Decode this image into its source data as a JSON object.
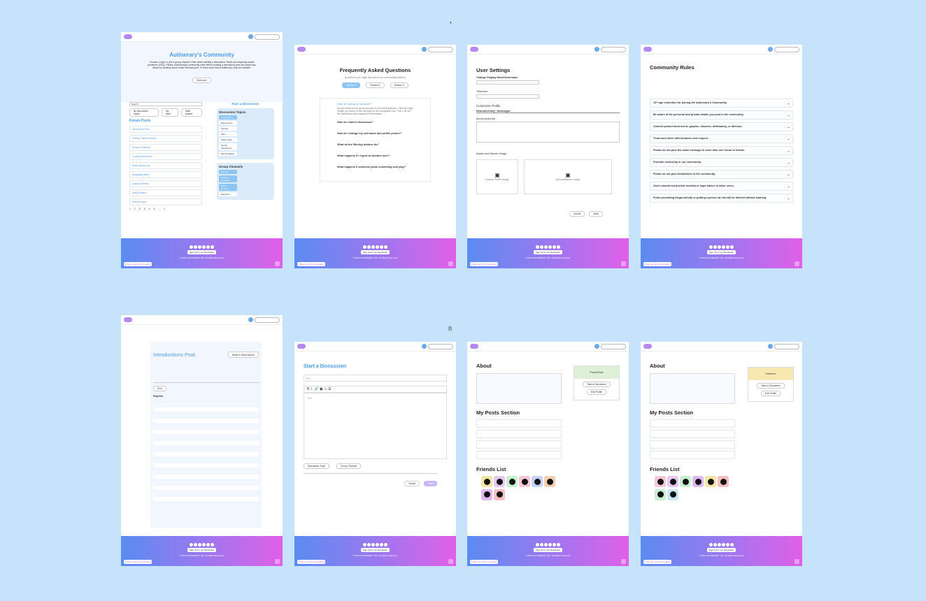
{
  "labels": {
    "a": "•",
    "b": "B"
  },
  "footer": {
    "newsletter": "Sign Up for our Newsletter",
    "crowd": "♥ See our K-S's Campaign!",
    "copy": "© 2024 AUTINERARY INC. All Rights Reserved."
  },
  "home": {
    "title": "Autinerary's Community",
    "intro": "Choose a topic or join a group channel. Filter when starting a discussion. Read our frequently asked questions (FAQ). Please read through community rules before posting a discussion post and report any abuse by clicking report under relevant post. To learn more about Autinerary, visit our website.",
    "visit": "Visit now!",
    "search": "Search",
    "filters": [
      "By discussion topics",
      "By likes",
      "Date posted"
    ],
    "forum_heading": "Forum Posts",
    "posts": [
      "Introduction Post",
      "Finding Comfort Spaces",
      "Sensory Overload",
      "Coping with Burnout",
      "Stimming and Joy",
      "Navigating Work",
      "Special Interests",
      "Daily Routines",
      "Self-Advocacy"
    ],
    "start": "Start a Discussion",
    "topics_heading": "Discussion Topics",
    "topics": [
      "Introductions",
      "Experiences",
      "Venting",
      "Wins",
      "Asking Help",
      "Social Interactions",
      "Mental Health"
    ],
    "groups_heading": "Group Channels",
    "groups": [
      "Gaming",
      "Artists & Creatives",
      "Parent Network",
      "Explorers"
    ],
    "pagination": [
      "<",
      "1",
      "2",
      "3",
      "4",
      "5",
      "...",
      ">"
    ]
  },
  "faq": {
    "title": "Frequently Asked Questions",
    "subtitle": "Questions you might ask about our community platform",
    "tabs": [
      "Section 1",
      "Section 2",
      "Section 3"
    ],
    "questions": [
      "How do I set up an account?",
      "How do I start a discussion?",
      "How do I change my username and profile picture?",
      "What do the filtering buttons do?",
      "What happens if I report an another user?",
      "What happens if someone posts something worrying?"
    ],
    "answer": "All you need to set up an account is an email address. Click the sign in/sign up button in the top right of the navigation bar. Then, fill out the username and password information."
  },
  "settings": {
    "title": "User Settings",
    "display": "Change Display Name/Username",
    "timezone": "Timezone",
    "customize": "Customize Profile",
    "neuro": "Neurodiversity / Neurotype",
    "about": "About (optional)",
    "avatar": "Avatar and Banner Image",
    "upload_avatar": "Upload Profile Image",
    "upload_banner": "Upload Banner Image",
    "cancel": "Cancel",
    "save": "Save"
  },
  "rules": {
    "title": "Community Rules",
    "items": [
      "13+ age restriction for joining the Autinerary's Community.",
      "Be aware of the personal and private details you post in the community.",
      "Content posted must not be graphic, obscene, defamatory, or libelous.",
      "Treat each other with kindness and respect.",
      "Please do not post the same message to more than one forum or thread.",
      "Promote inclusivity in our community.",
      "Please do not post fundraisers to the community.",
      "Users should not provide medical or legal advice to other users.",
      "Posts promoting illegal activity or putting a person at risk will be deleted without warning."
    ]
  },
  "intro_post": {
    "title": "Introductions Post",
    "start": "Start a Discussion",
    "replies": "Replies",
    "reply": "Reply",
    "post": "Post"
  },
  "new_disc": {
    "title": "Start a Discussion",
    "title_ph": "Title",
    "text_ph": "Text",
    "topic": "Discussion Topic",
    "channel": "Group Channel",
    "cancel": "Cancel",
    "post": "Post"
  },
  "profile1": {
    "about": "About",
    "posts": "My Posts Section",
    "friends": "Friends List",
    "start": "Start a Discussion",
    "edit": "Edit Profile",
    "name": "PuzzleRose"
  },
  "profile2": {
    "about": "About",
    "posts": "My Posts Section",
    "friends": "Friends List",
    "start": "Start a Discussion",
    "edit": "Edit Profile",
    "name": "Dreamer"
  },
  "colors": {
    "bg": "#c7e3fb",
    "accent": "#4a9ae5",
    "friends": [
      "#f5e6a8",
      "#e8c7f5",
      "#c7f0d0",
      "#f5c7d8",
      "#c7d0f5",
      "#f5d0b0",
      "#e0b8f0",
      "#f5c0c0"
    ]
  }
}
